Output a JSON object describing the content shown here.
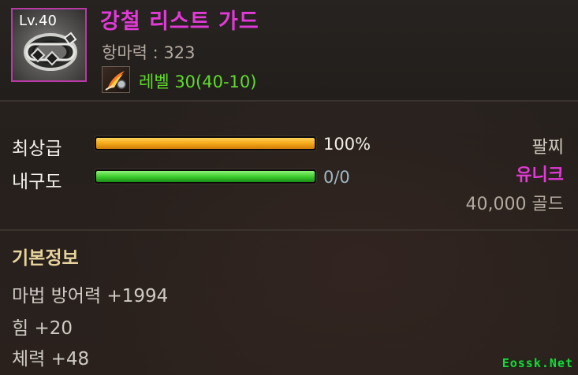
{
  "item": {
    "level_badge": "Lv.40",
    "name": "강철 리스트 가드",
    "main_stat": "항마력 : 323",
    "level_requirement": "레벨 30(40-10)",
    "icon": "steel-wrist-guard-icon",
    "skill_icon": "flame-feather-icon"
  },
  "bars": {
    "grade": {
      "label": "최상급",
      "value_text": "100%",
      "fraction": 1.0,
      "color": "#f4a918"
    },
    "durability": {
      "label": "내구도",
      "value_text": "0/0",
      "fraction": 1.0,
      "color": "#3fcf2e"
    }
  },
  "meta": {
    "slot": "팔찌",
    "rarity": "유니크",
    "rarity_color": "#e23ad7",
    "price": "40,000 골드"
  },
  "basic_info": {
    "title": "기본정보",
    "lines": [
      "마법 방어력 +1994",
      "힘 +20",
      "체력 +48"
    ]
  },
  "watermark": "Eossk.Net"
}
